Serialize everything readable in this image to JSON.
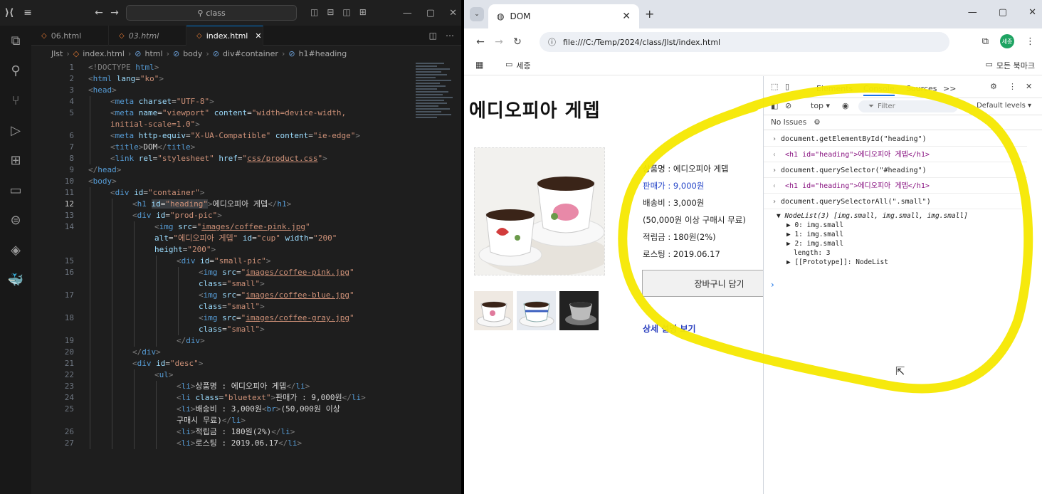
{
  "vscode": {
    "command_center": "class",
    "tabs": [
      {
        "label": "06.html",
        "active": false,
        "italic": false
      },
      {
        "label": "03.html",
        "active": false,
        "italic": true
      },
      {
        "label": "index.html",
        "active": true,
        "italic": false
      }
    ],
    "breadcrumb": [
      "Jlst",
      "index.html",
      "html",
      "body",
      "div#container",
      "h1#heading"
    ],
    "current_line": 12,
    "lines": [
      {
        "n": "1",
        "indent": 0,
        "html": "<span class='tk-p'>&lt;!DOCTYPE </span><span class='tk-tag'>html</span><span class='tk-p'>&gt;</span>"
      },
      {
        "n": "2",
        "indent": 0,
        "html": "<span class='tk-p'>&lt;</span><span class='tk-tag'>html</span> <span class='tk-attr'>lang</span>=<span class='tk-str'>\"ko\"</span><span class='tk-p'>&gt;</span>"
      },
      {
        "n": "3",
        "indent": 0,
        "html": "<span class='tk-p'>&lt;</span><span class='tk-tag'>head</span><span class='tk-p'>&gt;</span>"
      },
      {
        "n": "4",
        "indent": 1,
        "html": "<span class='tk-p'>&lt;</span><span class='tk-tag'>meta</span> <span class='tk-attr'>charset</span>=<span class='tk-str'>\"UTF-8\"</span><span class='tk-p'>&gt;</span>"
      },
      {
        "n": "5",
        "indent": 1,
        "html": "<span class='tk-p'>&lt;</span><span class='tk-tag'>meta</span> <span class='tk-attr'>name</span>=<span class='tk-str'>\"viewport\"</span> <span class='tk-attr'>content</span>=<span class='tk-str'>\"width=device-width,</span>"
      },
      {
        "n": "",
        "indent": 1,
        "html": "<span class='tk-str'>initial-scale=1.0\"</span><span class='tk-p'>&gt;</span>"
      },
      {
        "n": "6",
        "indent": 1,
        "html": "<span class='tk-p'>&lt;</span><span class='tk-tag'>meta</span> <span class='tk-attr'>http-equiv</span>=<span class='tk-str'>\"X-UA-Compatible\"</span> <span class='tk-attr'>content</span>=<span class='tk-str'>\"ie-edge\"</span><span class='tk-p'>&gt;</span>"
      },
      {
        "n": "7",
        "indent": 1,
        "html": "<span class='tk-p'>&lt;</span><span class='tk-tag'>title</span><span class='tk-p'>&gt;</span><span class='tk-txt'>DOM</span><span class='tk-p'>&lt;/</span><span class='tk-tag'>title</span><span class='tk-p'>&gt;</span>"
      },
      {
        "n": "8",
        "indent": 1,
        "html": "<span class='tk-p'>&lt;</span><span class='tk-tag'>link</span> <span class='tk-attr'>rel</span>=<span class='tk-str'>\"stylesheet\"</span> <span class='tk-attr'>href</span>=<span class='tk-str'>\"</span><span class='tk-link'>css/product.css</span><span class='tk-str'>\"</span><span class='tk-p'>&gt;</span>"
      },
      {
        "n": "9",
        "indent": 0,
        "html": "<span class='tk-p'>&lt;/</span><span class='tk-tag'>head</span><span class='tk-p'>&gt;</span>"
      },
      {
        "n": "10",
        "indent": 0,
        "html": "<span class='tk-p'>&lt;</span><span class='tk-tag'>body</span><span class='tk-p'>&gt;</span>"
      },
      {
        "n": "11",
        "indent": 1,
        "html": "<span class='tk-p'>&lt;</span><span class='tk-tag'>div</span> <span class='tk-attr'>id</span>=<span class='tk-str'>\"container\"</span><span class='tk-p'>&gt;</span>"
      },
      {
        "n": "12",
        "indent": 2,
        "html": "<span class='tk-p'>&lt;</span><span class='tk-tag'>h1</span> <span class='tk-hl'><span class='tk-attr'>id</span>=<span class='tk-str'>\"heading\"</span></span><span class='tk-p'>&gt;</span><span class='tk-txt'>에디오피아 게뎁</span><span class='tk-p'>&lt;/</span><span class='tk-tag'>h1</span><span class='tk-p'>&gt;</span>"
      },
      {
        "n": "13",
        "indent": 2,
        "html": "<span class='tk-p'>&lt;</span><span class='tk-tag'>div</span> <span class='tk-attr'>id</span>=<span class='tk-str'>\"prod-pic\"</span><span class='tk-p'>&gt;</span>"
      },
      {
        "n": "14",
        "indent": 3,
        "html": "<span class='tk-p'>&lt;</span><span class='tk-tag'>img</span> <span class='tk-attr'>src</span>=<span class='tk-str'>\"</span><span class='tk-link'>images/coffee-pink.jpg</span><span class='tk-str'>\"</span>"
      },
      {
        "n": "",
        "indent": 3,
        "html": "<span class='tk-attr'>alt</span>=<span class='tk-str'>\"에디오피아 게뎁\"</span> <span class='tk-attr'>id</span>=<span class='tk-str'>\"cup\"</span> <span class='tk-attr'>width</span>=<span class='tk-str'>\"200\"</span>"
      },
      {
        "n": "",
        "indent": 3,
        "html": "<span class='tk-attr'>height</span>=<span class='tk-str'>\"200\"</span><span class='tk-p'>&gt;</span>"
      },
      {
        "n": "15",
        "indent": 4,
        "html": "<span class='tk-p'>&lt;</span><span class='tk-tag'>div</span> <span class='tk-attr'>id</span>=<span class='tk-str'>\"small-pic\"</span><span class='tk-p'>&gt;</span>"
      },
      {
        "n": "16",
        "indent": 5,
        "html": "<span class='tk-p'>&lt;</span><span class='tk-tag'>img</span> <span class='tk-attr'>src</span>=<span class='tk-str'>\"</span><span class='tk-link'>images/coffee-pink.jpg</span><span class='tk-str'>\"</span>"
      },
      {
        "n": "",
        "indent": 5,
        "html": "<span class='tk-attr'>class</span>=<span class='tk-str'>\"small\"</span><span class='tk-p'>&gt;</span>"
      },
      {
        "n": "17",
        "indent": 5,
        "html": "<span class='tk-p'>&lt;</span><span class='tk-tag'>img</span> <span class='tk-attr'>src</span>=<span class='tk-str'>\"</span><span class='tk-link'>images/coffee-blue.jpg</span><span class='tk-str'>\"</span>"
      },
      {
        "n": "",
        "indent": 5,
        "html": "<span class='tk-attr'>class</span>=<span class='tk-str'>\"small\"</span><span class='tk-p'>&gt;</span>"
      },
      {
        "n": "18",
        "indent": 5,
        "html": "<span class='tk-p'>&lt;</span><span class='tk-tag'>img</span> <span class='tk-attr'>src</span>=<span class='tk-str'>\"</span><span class='tk-link'>images/coffee-gray.jpg</span><span class='tk-str'>\"</span>"
      },
      {
        "n": "",
        "indent": 5,
        "html": "<span class='tk-attr'>class</span>=<span class='tk-str'>\"small\"</span><span class='tk-p'>&gt;</span>"
      },
      {
        "n": "19",
        "indent": 4,
        "html": "<span class='tk-p'>&lt;/</span><span class='tk-tag'>div</span><span class='tk-p'>&gt;</span>"
      },
      {
        "n": "20",
        "indent": 2,
        "html": "<span class='tk-p'>&lt;/</span><span class='tk-tag'>div</span><span class='tk-p'>&gt;</span>"
      },
      {
        "n": "21",
        "indent": 2,
        "html": "<span class='tk-p'>&lt;</span><span class='tk-tag'>div</span> <span class='tk-attr'>id</span>=<span class='tk-str'>\"desc\"</span><span class='tk-p'>&gt;</span>"
      },
      {
        "n": "22",
        "indent": 3,
        "html": "<span class='tk-p'>&lt;</span><span class='tk-tag'>ul</span><span class='tk-p'>&gt;</span>"
      },
      {
        "n": "23",
        "indent": 4,
        "html": "<span class='tk-p'>&lt;</span><span class='tk-tag'>li</span><span class='tk-p'>&gt;</span><span class='tk-txt'>상품명 : 에디오피아 게뎁</span><span class='tk-p'>&lt;/</span><span class='tk-tag'>li</span><span class='tk-p'>&gt;</span>"
      },
      {
        "n": "24",
        "indent": 4,
        "html": "<span class='tk-p'>&lt;</span><span class='tk-tag'>li</span> <span class='tk-attr'>class</span>=<span class='tk-str'>\"bluetext\"</span><span class='tk-p'>&gt;</span><span class='tk-txt'>판매가 : 9,000원</span><span class='tk-p'>&lt;/</span><span class='tk-tag'>li</span><span class='tk-p'>&gt;</span>"
      },
      {
        "n": "25",
        "indent": 4,
        "html": "<span class='tk-p'>&lt;</span><span class='tk-tag'>li</span><span class='tk-p'>&gt;</span><span class='tk-txt'>배송비 : 3,000원</span><span class='tk-p'>&lt;</span><span class='tk-tag'>br</span><span class='tk-p'>&gt;</span><span class='tk-txt'>(50,000원 이상</span>"
      },
      {
        "n": "",
        "indent": 4,
        "html": "<span class='tk-txt'>구매시 무료)</span><span class='tk-p'>&lt;/</span><span class='tk-tag'>li</span><span class='tk-p'>&gt;</span>"
      },
      {
        "n": "26",
        "indent": 4,
        "html": "<span class='tk-p'>&lt;</span><span class='tk-tag'>li</span><span class='tk-p'>&gt;</span><span class='tk-txt'>적립금 : 180원(2%)</span><span class='tk-p'>&lt;/</span><span class='tk-tag'>li</span><span class='tk-p'>&gt;</span>"
      },
      {
        "n": "27",
        "indent": 4,
        "html": "<span class='tk-p'>&lt;</span><span class='tk-tag'>li</span><span class='tk-p'>&gt;</span><span class='tk-txt'>로스팅 : 2019.06.17</span><span class='tk-p'>&lt;/</span><span class='tk-tag'>li</span><span class='tk-p'>&gt;</span>"
      }
    ]
  },
  "browser": {
    "tab_title": "DOM",
    "url": "file:///C:/Temp/2024/class/Jlst/index.html",
    "profile_initial": "세종",
    "bookmark_folder": "세종",
    "all_bookmarks": "모든 북마크",
    "page": {
      "heading": "에디오피아 게뎁",
      "desc": {
        "name": "상품명 : 에디오피아 게뎁",
        "price": "판매가 : 9,000원",
        "shipping": "배송비 : 3,000원",
        "shipping_note": "(50,000원 이상 구매시 무료)",
        "points": "적립금 : 180원(2%)",
        "roasting": "로스팅 : 2019.06.17"
      },
      "cart_button": "장바구니 담기",
      "detail_link": "상세 설명 보기"
    },
    "devtools": {
      "tabs": [
        "Elements",
        "Console",
        "Sources"
      ],
      "active_tab": "Console",
      "more_tabs": ">>",
      "context": "top ▾",
      "filter_placeholder": "Filter",
      "levels": "Default levels ▾",
      "issues": "No Issues",
      "console": [
        {
          "kind": "in",
          "text": "document.getElementById(\"heading\")"
        },
        {
          "kind": "out",
          "text": "<h1 id=\"heading\">에디오피아 게뎁</h1>"
        },
        {
          "kind": "in",
          "text": "document.querySelector(\"#heading\")"
        },
        {
          "kind": "out",
          "text": "<h1 id=\"heading\">에디오피아 게뎁</h1>"
        },
        {
          "kind": "in",
          "text": "document.querySelectorAll(\".small\")"
        }
      ],
      "nodelist_header": "▼ NodeList(3) [img.small, img.small, img.small]",
      "nodelist_items": [
        "▶ 0: img.small",
        "▶ 1: img.small",
        "▶ 2: img.small",
        "length: 3",
        "▶ [[Prototype]]: NodeList"
      ],
      "prompt": "›"
    }
  },
  "colors": {
    "annotation": "#f5e800",
    "accent": "#0078d4",
    "blue_text": "#2545c8"
  }
}
